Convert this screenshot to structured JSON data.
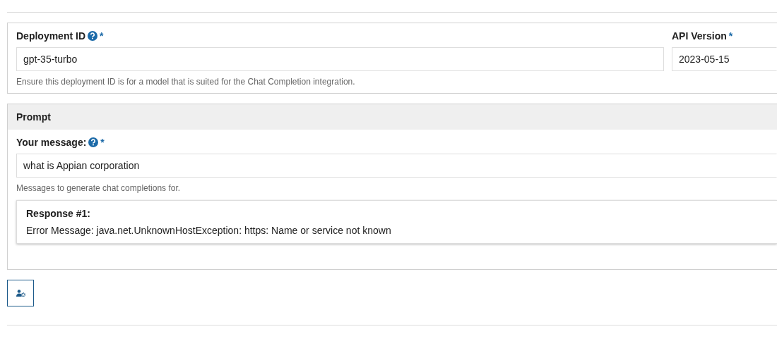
{
  "config": {
    "deployment_id": {
      "label": "Deployment ID",
      "help": true,
      "required_mark": "*",
      "value": "gpt-35-turbo",
      "instructions": "Ensure this deployment ID is for a model that is suited for the Chat Completion integration."
    },
    "api_version": {
      "label": "API Version",
      "required_mark": "*",
      "value": "2023-05-15"
    }
  },
  "prompt": {
    "title": "Prompt",
    "message": {
      "label": "Your message:",
      "help": true,
      "required_mark": "*",
      "value": "what is Appian corporation",
      "instructions": "Messages to generate chat completions for."
    },
    "responses": [
      {
        "title": "Response #1:",
        "text": "Error Message: java.net.UnknownHostException: https: Name or service not known"
      }
    ]
  },
  "actions": [
    {
      "kind": "user-settings"
    }
  ]
}
